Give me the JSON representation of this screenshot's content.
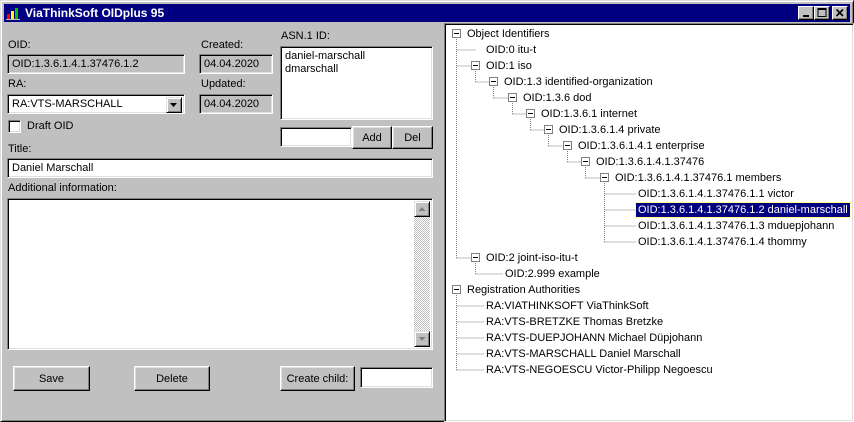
{
  "window": {
    "title": "ViaThinkSoft OIDplus 95"
  },
  "form": {
    "oid_label": "OID:",
    "oid_value": "OID:1.3.6.1.4.1.37476.1.2",
    "created_label": "Created:",
    "created_value": "04.04.2020",
    "updated_label": "Updated:",
    "updated_value": "04.04.2020",
    "ra_label": "RA:",
    "ra_value": "RA:VTS-MARSCHALL",
    "asn1_label": "ASN.1 ID:",
    "asn1_ids": [
      "daniel-marschall",
      "dmarschall"
    ],
    "asn1_input": "",
    "add_label": "Add",
    "del_label": "Del",
    "draft_label": "Draft OID",
    "draft_checked": false,
    "title_label": "Title:",
    "title_value": "Daniel Marschall",
    "info_label": "Additional information:",
    "info_value": "",
    "save_label": "Save",
    "delete_label": "Delete",
    "create_child_label": "Create child:",
    "create_child_value": ""
  },
  "tree": {
    "nodes": [
      "Object Identifiers",
      "OID:0 itu-t",
      "OID:1 iso",
      "OID:1.3 identified-organization",
      "OID:1.3.6 dod",
      "OID:1.3.6.1 internet",
      "OID:1.3.6.1.4 private",
      "OID:1.3.6.1.4.1 enterprise",
      "OID:1.3.6.1.4.1.37476",
      "OID:1.3.6.1.4.1.37476.1 members",
      "OID:1.3.6.1.4.1.37476.1.1 victor",
      "OID:1.3.6.1.4.1.37476.1.2 daniel-marschall",
      "OID:1.3.6.1.4.1.37476.1.3 mduepjohann",
      "OID:1.3.6.1.4.1.37476.1.4 thommy",
      "OID:2 joint-iso-itu-t",
      "OID:2.999 example",
      "Registration Authorities",
      "RA:VIATHINKSOFT ViaThinkSoft",
      "RA:VTS-BRETZKE Thomas Bretzke",
      "RA:VTS-DUEPJOHANN Michael Düpjohann",
      "RA:VTS-MARSCHALL Daniel Marschall",
      "RA:VTS-NEGOESCU Victor-Philipp Negoescu"
    ],
    "selected": "OID:1.3.6.1.4.1.37476.1.2 daniel-marschall"
  },
  "colors": {
    "face": "#c0c0c0",
    "titlebar": "#000080",
    "selection": "#000080"
  }
}
